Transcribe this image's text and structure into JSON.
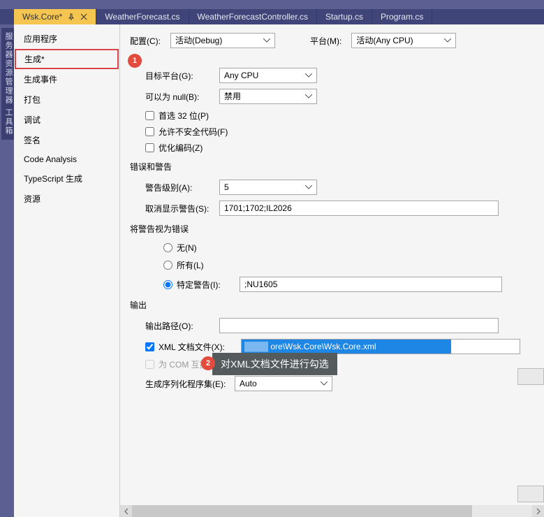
{
  "tabs": [
    {
      "label": "Wsk.Core*",
      "active": true
    },
    {
      "label": "WeatherForecast.cs",
      "active": false
    },
    {
      "label": "WeatherForecastController.cs",
      "active": false
    },
    {
      "label": "Startup.cs",
      "active": false
    },
    {
      "label": "Program.cs",
      "active": false
    }
  ],
  "vertical_tab": "服务器资源管理器  工具箱",
  "sidebar": {
    "items": [
      "应用程序",
      "生成*",
      "生成事件",
      "打包",
      "调试",
      "签名",
      "Code Analysis",
      "TypeScript 生成",
      "资源"
    ],
    "highlighted_index": 1
  },
  "config_top": {
    "config_label": "配置(C):",
    "config_value": "活动(Debug)",
    "platform_label": "平台(M):",
    "platform_value": "活动(Any CPU)"
  },
  "general": {
    "target_platform_label": "目标平台(G):",
    "target_platform_value": "Any CPU",
    "nullable_label": "可以为 null(B):",
    "nullable_value": "禁用",
    "prefer32_label": "首选 32 位(P)",
    "unsafe_label": "允许不安全代码(F)",
    "optimize_label": "优化编码(Z)"
  },
  "errors": {
    "section": "错误和警告",
    "warn_level_label": "警告级别(A):",
    "warn_level_value": "5",
    "suppress_label": "取消显示警告(S):",
    "suppress_value": "1701;1702;IL2026"
  },
  "treat": {
    "section": "将警告视为错误",
    "none_label": "无(N)",
    "all_label": "所有(L)",
    "specific_label": "特定警告(I):",
    "specific_value": ";NU1605"
  },
  "output": {
    "section": "输出",
    "path_label": "输出路径(O):",
    "path_value": "",
    "xml_label": "XML 文档文件(X):",
    "xml_value": "ore\\Wsk.Core\\Wsk.Core.xml",
    "com_label": "为 COM 互操作注册(C)",
    "serializer_label": "生成序列化程序集(E):",
    "serializer_value": "Auto"
  },
  "callouts": {
    "c1": "1",
    "c2": "2",
    "tooltip": "对XML文档文件进行勾选"
  }
}
